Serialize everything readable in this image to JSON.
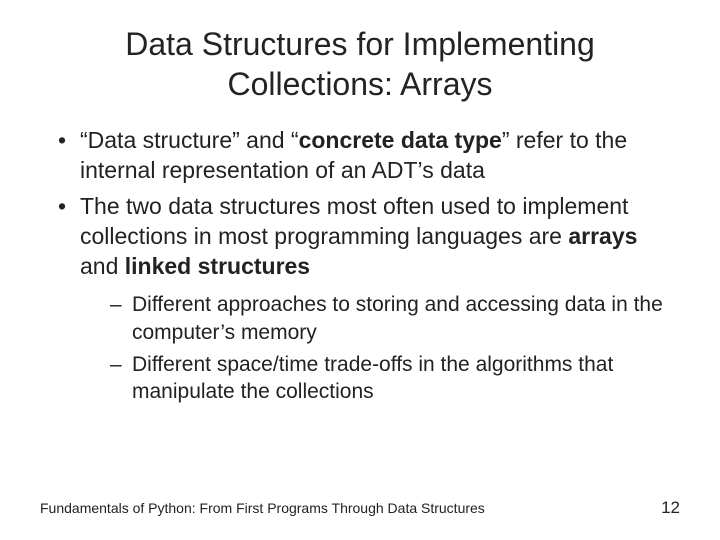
{
  "title": "Data Structures for Implementing Collections: Arrays",
  "bullets": {
    "b1_pre": "“Data structure” and “",
    "b1_bold": "concrete data type",
    "b1_post": "” refer to the internal representation of an ADT’s data",
    "b2_pre": "The two data structures most often used to implement collections in most programming languages are ",
    "b2_bold1": "arrays",
    "b2_mid": " and ",
    "b2_bold2": "linked structures",
    "sub1": "Different approaches to storing and accessing data in the computer’s memory",
    "sub2": "Different space/time trade-offs in the algorithms that manipulate the collections"
  },
  "footer": {
    "source": "Fundamentals of Python: From First Programs Through Data Structures",
    "page": "12"
  }
}
